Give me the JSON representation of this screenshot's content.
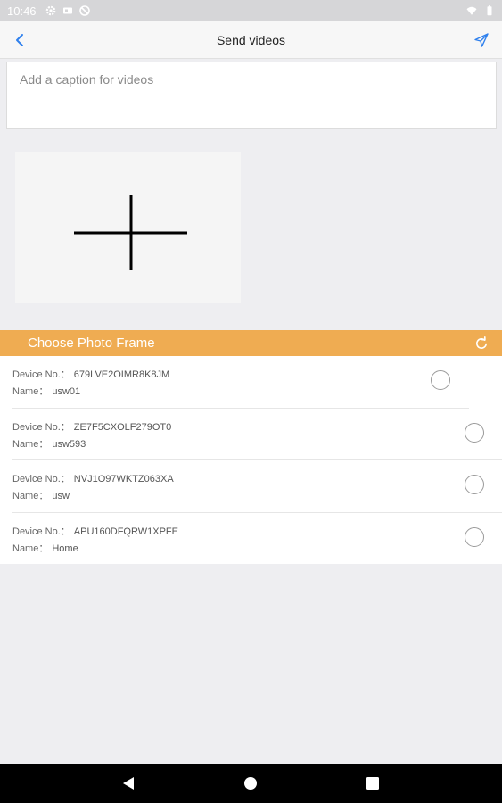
{
  "status_bar": {
    "time": "10:46",
    "left_icons": [
      "settings-icon",
      "sim-card-icon",
      "no-data-icon"
    ],
    "right_icons": [
      "wifi-icon",
      "battery-icon"
    ]
  },
  "app_bar": {
    "title": "Send videos",
    "back_icon": "chevron-left-icon",
    "send_icon": "send-icon",
    "accent_color": "#2f80ed"
  },
  "caption": {
    "placeholder": "Add a caption for videos",
    "value": ""
  },
  "add_video": {
    "icon": "plus-icon"
  },
  "frames": {
    "header_title": "Choose Photo Frame",
    "header_color": "#efac52",
    "refresh_icon": "refresh-icon",
    "devices": [
      {
        "no_label": "Device No.：",
        "no": "679LVE2OIMR8K8JM",
        "name_label": "Name：",
        "name": "usw01",
        "selected": false
      },
      {
        "no_label": "Device No.：",
        "no": "ZE7F5CXOLF279OT0",
        "name_label": "Name：",
        "name": "usw593",
        "selected": false
      },
      {
        "no_label": "Device No.：",
        "no": "NVJ1O97WKTZ063XA",
        "name_label": "Name：",
        "name": "usw",
        "selected": false
      },
      {
        "no_label": "Device No.：",
        "no": "APU160DFQRW1XPFE",
        "name_label": "Name：",
        "name": "Home",
        "selected": false
      }
    ]
  },
  "nav_bar": {
    "buttons": [
      "back-triangle-icon",
      "home-circle-icon",
      "recents-square-icon"
    ]
  }
}
